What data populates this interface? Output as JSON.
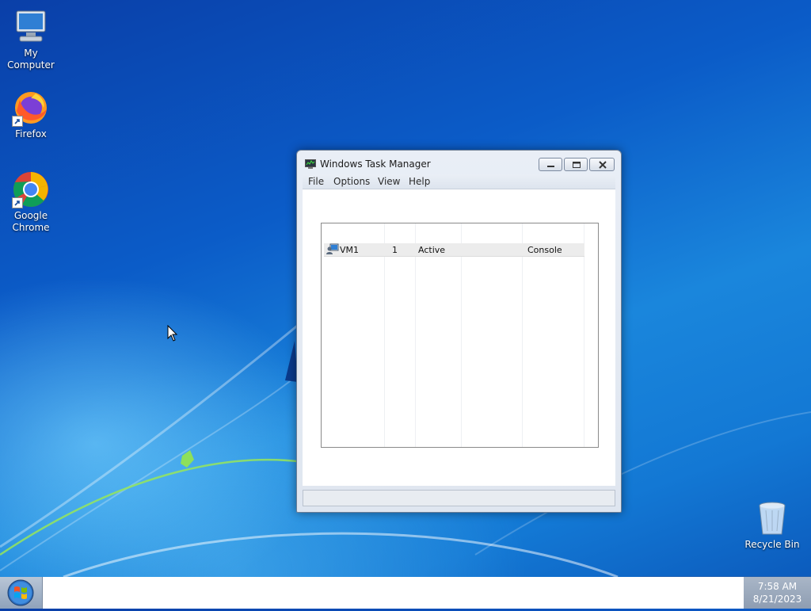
{
  "desktop": {
    "icons": [
      {
        "label": "My Computer",
        "icon": "computer-icon"
      },
      {
        "label": "Firefox",
        "icon": "firefox-icon"
      },
      {
        "label": "Google Chrome",
        "icon": "chrome-icon"
      },
      {
        "label": "Recycle Bin",
        "icon": "recycle-bin-icon"
      }
    ]
  },
  "window": {
    "title": "Windows Task Manager",
    "icon": "task-manager-icon",
    "menu": [
      "File",
      "Options",
      "View",
      "Help"
    ],
    "users_table": {
      "rows": [
        {
          "user": "VM1",
          "id": "1",
          "status": "Active",
          "client_name": "",
          "session": "Console",
          "icon": "user-session-icon"
        }
      ]
    }
  },
  "taskbar": {
    "start_icon": "windows-orb-icon",
    "clock": {
      "time": "7:58 AM",
      "date": "8/21/2023"
    }
  }
}
